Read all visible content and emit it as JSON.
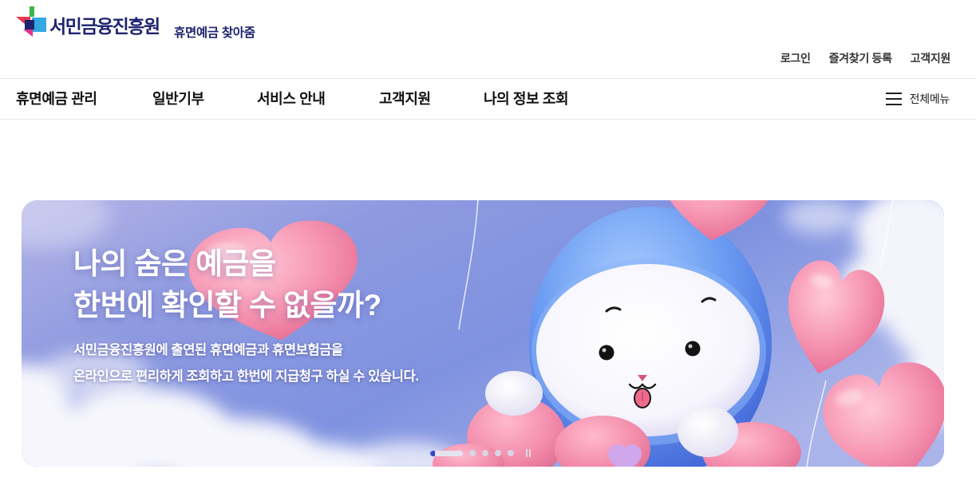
{
  "brand": {
    "org_name": "서민금융진흥원",
    "service_name": "휴면예금 찾아줌",
    "logo_icon": "logo-mark-icon"
  },
  "utility_links": [
    {
      "label": "로그인"
    },
    {
      "label": "즐겨찾기 등록"
    },
    {
      "label": "고객지원"
    }
  ],
  "nav": {
    "items": [
      {
        "label": "휴면예금 관리"
      },
      {
        "label": "일반기부"
      },
      {
        "label": "서비스 안내"
      },
      {
        "label": "고객지원"
      },
      {
        "label": "나의 정보 조회"
      }
    ],
    "all_menu_label": "전체메뉴",
    "all_menu_icon": "hamburger-icon"
  },
  "banner": {
    "headline": [
      "나의 숨은 예금을",
      "한번에 확인할 수 없을까?"
    ],
    "description": [
      "서민금융진흥원에 출연된 휴면예금과 휴면보험금을",
      "온라인으로 편리하게 조회하고 한번에 지급청구 하실 수 있습니다."
    ],
    "carousel": {
      "slides": [
        {
          "active": true,
          "progress": 0.15
        },
        {
          "active": false
        },
        {
          "active": false
        },
        {
          "active": false
        },
        {
          "active": false
        }
      ],
      "pause_icon": "pause-icon"
    }
  },
  "colors": {
    "brand_navy": "#1f2470",
    "nav_text": "#111111",
    "utility_text": "#333333",
    "divider": "#e6e6e6",
    "banner_text": "#ffffff",
    "indicator_active": "#3347c9",
    "indicator_track": "#e3e4ef",
    "all_menu_text": "#222222"
  }
}
